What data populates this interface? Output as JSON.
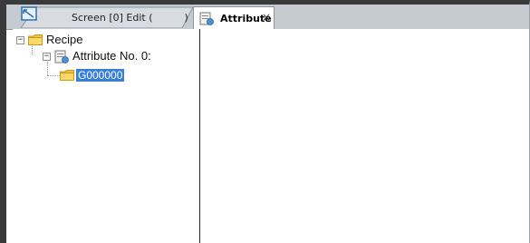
{
  "tabs": [
    {
      "label": "Screen [0] Edit (          )",
      "icon": "screen-edit-icon",
      "active": false
    },
    {
      "label": "Attribute",
      "icon": "attribute-icon",
      "active": true,
      "close": "×"
    }
  ],
  "tree": {
    "root": {
      "label": "Recipe",
      "icon": "folder-icon",
      "expander": "−"
    },
    "child": {
      "label": "Attribute No. 0:",
      "icon": "attribute-icon",
      "expander": "−"
    },
    "leaf": {
      "label": "G000000",
      "icon": "folder-icon",
      "selected": true
    }
  },
  "colors": {
    "selection": "#3a80d9",
    "folder": "#f5c542",
    "tabbar": "#c6cbd2"
  }
}
